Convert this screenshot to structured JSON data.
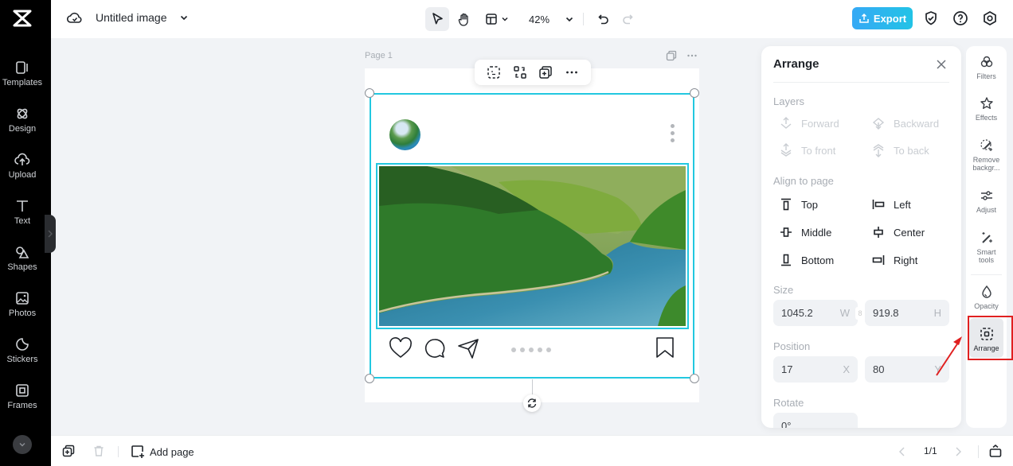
{
  "app": {
    "document_title": "Untitled image",
    "zoom_level": "42%",
    "export_label": "Export"
  },
  "sidebar": {
    "items": [
      {
        "label": "Templates",
        "icon": "templates-icon"
      },
      {
        "label": "Design",
        "icon": "design-icon"
      },
      {
        "label": "Upload",
        "icon": "upload-icon"
      },
      {
        "label": "Text",
        "icon": "text-icon"
      },
      {
        "label": "Shapes",
        "icon": "shapes-icon"
      },
      {
        "label": "Photos",
        "icon": "photos-icon"
      },
      {
        "label": "Stickers",
        "icon": "stickers-icon"
      },
      {
        "label": "Frames",
        "icon": "frames-icon"
      }
    ]
  },
  "canvas": {
    "page_label": "Page 1"
  },
  "arrange_panel": {
    "title": "Arrange",
    "layers_label": "Layers",
    "layers": [
      {
        "label": "Forward",
        "enabled": false
      },
      {
        "label": "Backward",
        "enabled": false
      },
      {
        "label": "To front",
        "enabled": false
      },
      {
        "label": "To back",
        "enabled": false
      }
    ],
    "align_label": "Align to page",
    "align": [
      {
        "label": "Top"
      },
      {
        "label": "Left"
      },
      {
        "label": "Middle"
      },
      {
        "label": "Center"
      },
      {
        "label": "Bottom"
      },
      {
        "label": "Right"
      }
    ],
    "size_label": "Size",
    "width_value": "1045.2",
    "width_unit": "W",
    "height_value": "919.8",
    "height_unit": "H",
    "position_label": "Position",
    "x_value": "17",
    "x_unit": "X",
    "y_value": "80",
    "y_unit": "Y",
    "rotate_label": "Rotate",
    "rotate_value": "0°"
  },
  "tool_strip": {
    "items": [
      {
        "label": "Filters"
      },
      {
        "label": "Effects"
      },
      {
        "label": "Remove backgr..."
      },
      {
        "label": "Adjust"
      },
      {
        "label": "Smart tools"
      },
      {
        "label": "Opacity"
      },
      {
        "label": "Arrange",
        "active": true
      }
    ]
  },
  "bottom_bar": {
    "add_page_label": "Add page",
    "page_count": "1/1"
  },
  "colors": {
    "accent": "#22c8e0",
    "export_gradient_start": "#36a9f5",
    "export_gradient_end": "#22c3e6",
    "highlight_box": "#e02020"
  }
}
